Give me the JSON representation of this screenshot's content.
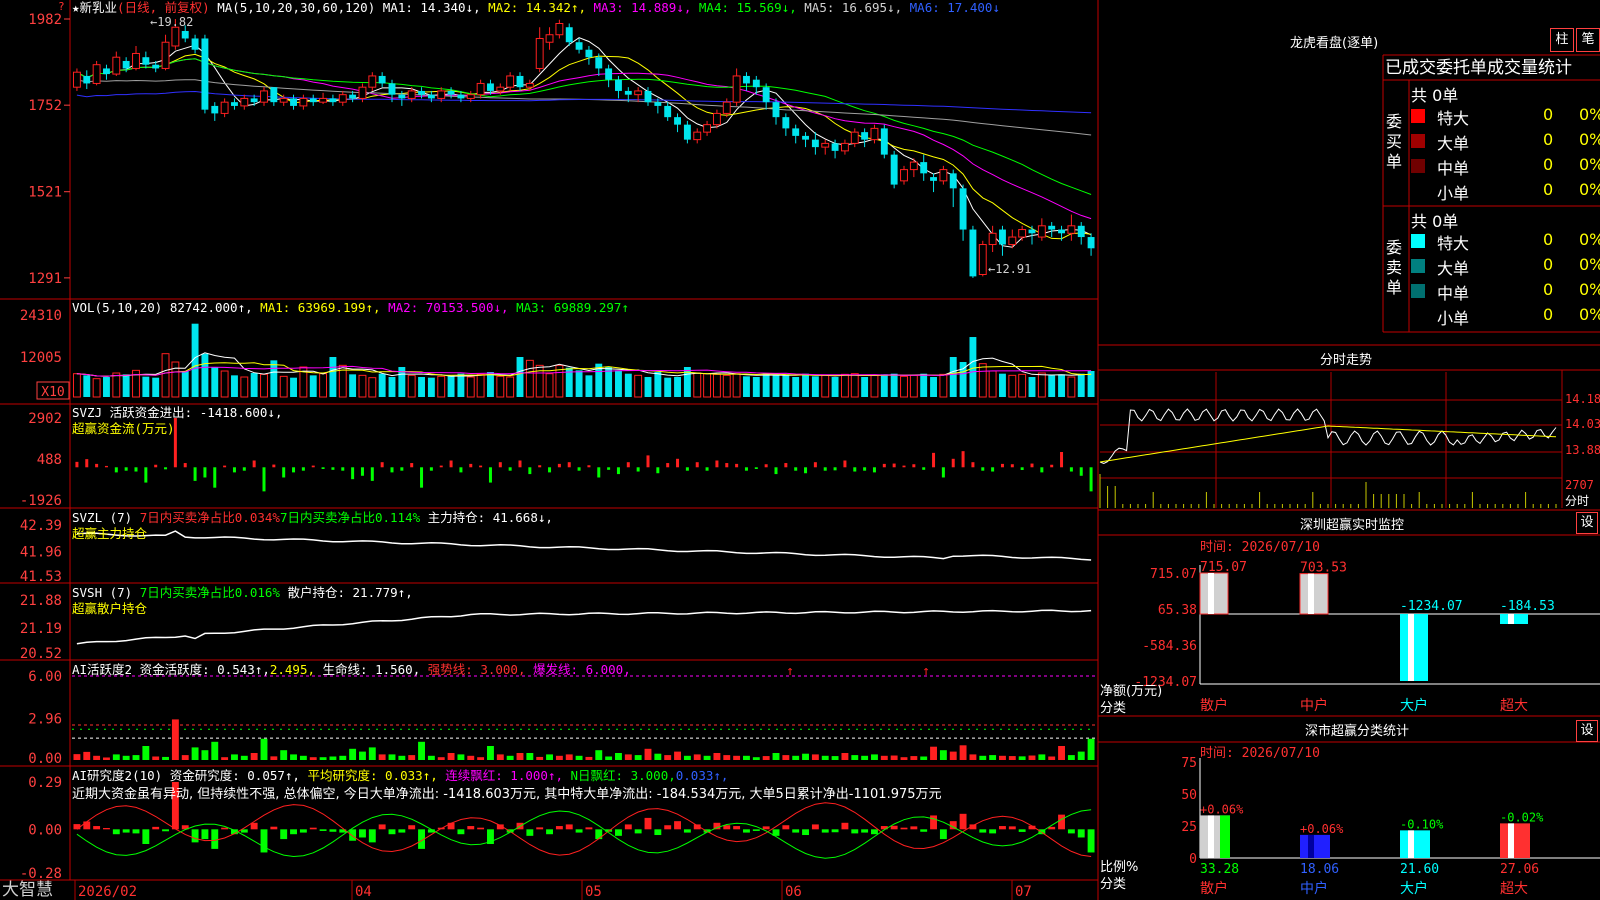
{
  "colors": {
    "up": "#ff2020",
    "down": "#00e5ee",
    "grid": "#b00000",
    "axis_text": "#ff4040",
    "ma1": "#ffffff",
    "ma2": "#ffff00",
    "ma3": "#ff00ff",
    "ma4": "#00ff00",
    "ma5": "#a0a0a0",
    "ma6": "#3030ff",
    "green_bar": "#00ff00",
    "gray_text": "#d0d0d0"
  },
  "header": {
    "star": "★",
    "stock_name": "新乳业",
    "period": "(日线, 前复权)",
    "ma_params": "MA(5,10,20,30,60,120)",
    "ma1": "MA1: 14.340↓,",
    "ma2": "MA2: 14.342↑,",
    "ma3": "MA3: 14.889↓,",
    "ma4": "MA4: 15.569↓,",
    "ma5": "MA5: 16.695↓,",
    "ma6": "MA6: 17.400↓",
    "high_label": "←19.82",
    "low_label": "←12.91",
    "scroll_icon": "?"
  },
  "chart_data": [
    {
      "type": "candlestick",
      "panel": "price",
      "y_ticks": [
        "1982",
        "1752",
        "1521",
        "1291"
      ],
      "ylim": [
        12.8,
        19.9
      ],
      "x_labels": [
        "2026/02",
        "04",
        "05",
        "06",
        "07"
      ],
      "high": 19.82,
      "low": 12.91,
      "candles": [
        [
          18.0,
          18.4,
          18.5,
          17.9
        ],
        [
          18.3,
          18.1,
          18.45,
          17.95
        ],
        [
          18.1,
          18.6,
          18.7,
          18.05
        ],
        [
          18.5,
          18.35,
          18.6,
          18.2
        ],
        [
          18.35,
          18.8,
          18.95,
          18.3
        ],
        [
          18.7,
          18.5,
          18.8,
          18.4
        ],
        [
          18.5,
          18.9,
          19.1,
          18.45
        ],
        [
          18.8,
          18.6,
          18.95,
          18.5
        ],
        [
          18.6,
          18.5,
          18.7,
          18.4
        ],
        [
          18.5,
          19.2,
          19.4,
          18.45
        ],
        [
          19.1,
          19.6,
          19.82,
          19.0
        ],
        [
          19.5,
          19.3,
          19.65,
          19.2
        ],
        [
          19.3,
          19.0,
          19.4,
          18.9
        ],
        [
          19.3,
          17.4,
          19.4,
          17.3
        ],
        [
          17.5,
          17.3,
          17.6,
          17.1
        ],
        [
          17.3,
          17.6,
          17.7,
          17.2
        ],
        [
          17.6,
          17.5,
          17.7,
          17.4
        ],
        [
          17.5,
          17.7,
          17.8,
          17.4
        ],
        [
          17.7,
          17.6,
          17.8,
          17.5
        ],
        [
          17.6,
          17.9,
          18.0,
          17.5
        ],
        [
          18.0,
          17.6,
          18.0,
          17.5
        ],
        [
          17.6,
          17.7,
          17.8,
          17.5
        ],
        [
          17.7,
          17.5,
          17.8,
          17.4
        ],
        [
          17.5,
          17.7,
          17.8,
          17.4
        ],
        [
          17.7,
          17.6,
          17.8,
          17.5
        ],
        [
          17.6,
          17.7,
          17.85,
          17.55
        ],
        [
          17.7,
          17.6,
          17.8,
          17.5
        ],
        [
          17.6,
          17.8,
          17.9,
          17.5
        ],
        [
          17.8,
          17.7,
          17.9,
          17.6
        ],
        [
          17.7,
          18.0,
          18.1,
          17.6
        ],
        [
          18.0,
          18.3,
          18.4,
          17.9
        ],
        [
          18.3,
          18.1,
          18.4,
          18.0
        ],
        [
          18.1,
          17.8,
          18.2,
          17.6
        ],
        [
          17.8,
          17.7,
          17.9,
          17.5
        ],
        [
          17.7,
          17.9,
          18.0,
          17.6
        ],
        [
          17.9,
          17.8,
          18.0,
          17.7
        ],
        [
          17.8,
          17.7,
          17.9,
          17.6
        ],
        [
          17.7,
          17.9,
          18.0,
          17.6
        ],
        [
          17.9,
          17.8,
          18.0,
          17.7
        ],
        [
          17.8,
          17.7,
          17.9,
          17.6
        ],
        [
          17.7,
          17.8,
          17.9,
          17.6
        ],
        [
          17.8,
          18.1,
          18.2,
          17.7
        ],
        [
          18.1,
          17.9,
          18.2,
          17.8
        ],
        [
          17.9,
          18.0,
          18.1,
          17.8
        ],
        [
          18.0,
          18.3,
          18.4,
          17.9
        ],
        [
          18.3,
          18.0,
          18.4,
          17.9
        ],
        [
          18.0,
          18.1,
          18.2,
          17.9
        ],
        [
          18.5,
          19.3,
          19.6,
          18.4
        ],
        [
          19.2,
          19.4,
          19.6,
          19.0
        ],
        [
          19.4,
          19.7,
          19.8,
          19.3
        ],
        [
          19.6,
          19.2,
          19.7,
          19.1
        ],
        [
          19.2,
          19.0,
          19.3,
          18.9
        ],
        [
          19.0,
          18.8,
          19.1,
          18.6
        ],
        [
          18.8,
          18.5,
          18.9,
          18.3
        ],
        [
          18.5,
          18.2,
          18.6,
          18.0
        ],
        [
          18.2,
          17.9,
          18.3,
          17.7
        ],
        [
          17.9,
          17.8,
          18.0,
          17.6
        ],
        [
          17.8,
          17.9,
          18.0,
          17.6
        ],
        [
          17.9,
          17.6,
          18.0,
          17.5
        ],
        [
          17.6,
          17.5,
          17.7,
          17.3
        ],
        [
          17.5,
          17.2,
          17.6,
          17.1
        ],
        [
          17.2,
          17.0,
          17.3,
          16.8
        ],
        [
          17.0,
          16.6,
          17.1,
          16.5
        ],
        [
          16.6,
          16.8,
          16.9,
          16.5
        ],
        [
          16.8,
          17.0,
          17.1,
          16.7
        ],
        [
          17.0,
          17.3,
          17.4,
          16.9
        ],
        [
          17.3,
          17.6,
          17.7,
          17.2
        ],
        [
          17.6,
          18.3,
          18.5,
          17.5
        ],
        [
          18.3,
          18.1,
          18.4,
          17.9
        ],
        [
          18.2,
          18.0,
          18.3,
          17.8
        ],
        [
          18.0,
          17.6,
          18.1,
          17.4
        ],
        [
          17.6,
          17.2,
          17.7,
          17.0
        ],
        [
          17.2,
          16.9,
          17.3,
          16.7
        ],
        [
          16.9,
          16.7,
          17.0,
          16.5
        ],
        [
          16.7,
          16.6,
          16.8,
          16.4
        ],
        [
          16.6,
          16.4,
          16.8,
          16.2
        ],
        [
          16.4,
          16.5,
          16.6,
          16.2
        ],
        [
          16.5,
          16.3,
          16.6,
          16.1
        ],
        [
          16.3,
          16.5,
          16.6,
          16.2
        ],
        [
          16.5,
          16.8,
          16.9,
          16.4
        ],
        [
          16.8,
          16.6,
          16.9,
          16.4
        ],
        [
          16.6,
          16.9,
          17.0,
          16.5
        ],
        [
          16.9,
          16.2,
          17.0,
          16.1
        ],
        [
          16.2,
          15.4,
          16.3,
          15.3
        ],
        [
          15.5,
          15.8,
          15.9,
          15.4
        ],
        [
          15.8,
          16.0,
          16.1,
          15.6
        ],
        [
          16.0,
          15.7,
          16.2,
          15.5
        ],
        [
          15.6,
          15.5,
          15.7,
          15.2
        ],
        [
          15.5,
          15.8,
          15.9,
          15.4
        ],
        [
          15.7,
          15.3,
          15.8,
          14.8
        ],
        [
          15.3,
          14.2,
          15.4,
          13.9
        ],
        [
          14.2,
          12.95,
          14.3,
          12.91
        ],
        [
          13.0,
          13.8,
          13.9,
          12.95
        ],
        [
          13.8,
          14.1,
          14.3,
          13.6
        ],
        [
          14.2,
          13.8,
          14.3,
          13.5
        ],
        [
          13.8,
          14.0,
          14.2,
          13.7
        ],
        [
          14.0,
          14.2,
          14.3,
          13.9
        ],
        [
          14.2,
          14.1,
          14.3,
          13.8
        ],
        [
          14.0,
          14.3,
          14.5,
          13.9
        ],
        [
          14.3,
          14.2,
          14.4,
          14.0
        ],
        [
          14.2,
          14.1,
          14.3,
          13.9
        ],
        [
          14.1,
          14.3,
          14.6,
          13.9
        ],
        [
          14.3,
          14.0,
          14.4,
          13.8
        ],
        [
          14.0,
          13.7,
          14.1,
          13.5
        ]
      ]
    },
    {
      "type": "bar",
      "panel": "volume",
      "label": "VOL(5,10,20)",
      "y_ticks": [
        "24310",
        "12005",
        "X10"
      ],
      "ylim": [
        0,
        24310
      ],
      "values": [
        7000,
        6500,
        5500,
        6000,
        7200,
        6800,
        8000,
        6100,
        5800,
        13000,
        10500,
        7800,
        22000,
        13000,
        9000,
        7800,
        6500,
        6000,
        7200,
        6800,
        11000,
        6200,
        5800,
        9000,
        6500,
        7000,
        12005,
        9500,
        6800,
        6500,
        5800,
        7000,
        6000,
        9000,
        6500,
        6000,
        5800,
        6200,
        6500,
        7000,
        6000,
        6800,
        7500,
        6200,
        6000,
        12005,
        11000,
        9500,
        7000,
        9500,
        8800,
        8000,
        6500,
        10000,
        9000,
        8000,
        7000,
        6500,
        6000,
        7500,
        5800,
        6000,
        9000,
        7200,
        7000,
        6800,
        6500,
        7000,
        6200,
        6000,
        7200,
        6500,
        6800,
        6000,
        7000,
        6200,
        6500,
        6000,
        6800,
        7000,
        6000,
        6500,
        6800,
        7000,
        6200,
        6500,
        7000,
        6000,
        6800,
        12005,
        10500,
        18000,
        10000,
        7800,
        7000,
        6500,
        6800,
        6000,
        7200,
        6500,
        6800,
        6000,
        7000,
        7800
      ],
      "vol_text": "82742.000↑,",
      "ma1": "MA1: 63969.199↑,",
      "ma2": "MA2: 70153.500↓,",
      "ma3": "MA3: 69889.297↑"
    },
    {
      "type": "bar",
      "panel": "capital_flow",
      "label": "SVZJ",
      "title": "超赢资金流(万元)",
      "y_ticks": [
        "2902",
        "488",
        "-1926"
      ],
      "ylim": [
        -1926,
        2902
      ],
      "values": [
        320,
        480,
        200,
        80,
        -300,
        -200,
        -250,
        -900,
        150,
        -120,
        2902,
        250,
        -800,
        -600,
        -1200,
        100,
        -300,
        -200,
        400,
        -1418,
        160,
        -600,
        -300,
        -200,
        100,
        -100,
        -150,
        -200,
        -700,
        -500,
        -800,
        300,
        -300,
        -200,
        250,
        -1200,
        -200,
        100,
        400,
        -300,
        200,
        100,
        -900,
        300,
        -200,
        400,
        -400,
        120,
        -300,
        200,
        300,
        -200,
        120,
        -600,
        -150,
        -400,
        300,
        -250,
        700,
        -350,
        250,
        500,
        -200,
        300,
        -200,
        400,
        250,
        200,
        -200,
        -100,
        180,
        -400,
        250,
        -200,
        -350,
        300,
        -200,
        -180,
        400,
        -250,
        -200,
        -300,
        200,
        220,
        100,
        180,
        -150,
        850,
        -600,
        500,
        950,
        300,
        -200,
        -250,
        200,
        180,
        -160,
        220,
        -300,
        150,
        900,
        -250,
        -500,
        -1418
      ]
    },
    {
      "type": "line",
      "panel": "main_holding",
      "label": "SVZL (7)",
      "title": "超赢主力持仓",
      "y_ticks": [
        "42.39",
        "41.96",
        "41.53"
      ],
      "ylim": [
        41.53,
        42.39
      ]
    },
    {
      "type": "line",
      "panel": "retail_holding",
      "label": "SVSH (7)",
      "title": "超赢散户持仓",
      "y_ticks": [
        "21.88",
        "21.19",
        "20.52"
      ],
      "ylim": [
        20.52,
        21.88
      ]
    },
    {
      "type": "bar",
      "panel": "ai_activity",
      "label": "AI活跃度2",
      "y_ticks": [
        "6.00",
        "2.96",
        "0.00"
      ],
      "ylim": [
        0,
        6
      ]
    },
    {
      "type": "bar",
      "panel": "ai_research",
      "label": "AI研究度2(10)",
      "y_ticks": [
        "0.29",
        "0.00",
        "-0.28"
      ],
      "ylim": [
        -0.28,
        0.29
      ]
    }
  ],
  "indicators": {
    "svzj_line": "活跃资金进出: -1418.600↓,",
    "svzl_a": "7日内买卖净占比0.034%",
    "svzl_b": "7日内买卖净占比0.114%",
    "svzl_c": "主力持仓: 41.668↓,",
    "svsh_a": "7日内买卖净占比0.016%",
    "svsh_b": "散户持仓: 21.779↑,",
    "ai_act_a": "资金活跃度: 0.543↑,",
    "ai_act_b": "2.495,",
    "ai_act_c": "生命线: 1.560,",
    "ai_act_d": "强势线: 3.000,",
    "ai_act_e": "爆发线: 6.000,",
    "ai_res_a": "资金研究度: 0.057↑,",
    "ai_res_b": "平均研究度: 0.033↑,",
    "ai_res_c": "连续飘红: 1.000↑,",
    "ai_res_d": "N日飘红: 3.000,",
    "ai_res_e": "0.033↑,",
    "summary": "近期大资金虽有异动, 但持续性不强, 总体偏空, 今日大单净流出: -1418.603万元, 其中特大单净流出: -184.534万元, 大单5日累计净出-1101.975万元"
  },
  "footer": {
    "brand": "大智慧"
  },
  "right_panel": {
    "lhb_title": "龙虎看盘(逐单)",
    "btn_zhu": "柱",
    "btn_bi": "笔",
    "order_header": "已成交委托单成交量统计",
    "buy_side_label": "委买单",
    "sell_side_label": "委卖单",
    "buy_total": "共 0单",
    "sell_total": "共 0单",
    "buy_rows": [
      {
        "label": "特大",
        "count": "0",
        "pct": "0%",
        "color": "#ff0000"
      },
      {
        "label": "大单",
        "count": "0",
        "pct": "0%",
        "color": "#a00000"
      },
      {
        "label": "中单",
        "count": "0",
        "pct": "0%",
        "color": "#700000"
      },
      {
        "label": "小单",
        "count": "0",
        "pct": "0%",
        "color": ""
      }
    ],
    "sell_rows": [
      {
        "label": "特大",
        "count": "0",
        "pct": "0%",
        "color": "#00ffff"
      },
      {
        "label": "大单",
        "count": "0",
        "pct": "0%",
        "color": "#008080"
      },
      {
        "label": "中单",
        "count": "0",
        "pct": "0%",
        "color": "#007070"
      },
      {
        "label": "小单",
        "count": "0",
        "pct": "0%",
        "color": ""
      }
    ],
    "intraday_title": "分时走势",
    "intraday_ticks": [
      "14.18",
      "14.03",
      "13.88",
      "2707",
      "分时"
    ],
    "sz_monitor_title": "深圳超赢实时监控",
    "sz_time": "时间: 2026/07/10",
    "sz_y_ticks": [
      "715.07",
      "65.38",
      "-584.36",
      "-1234.07"
    ],
    "sz_axis_label": "净额(万元)",
    "sz_axis_label2": "分类",
    "sz_categories": [
      "散户",
      "中户",
      "大户",
      "超大"
    ],
    "sz_values": [
      715.07,
      703.53,
      -1234.07,
      -184.53
    ],
    "sz_value_labels": [
      "715.07",
      "703.53",
      "-1234.07",
      "-184.53"
    ],
    "sz_set": "设",
    "sh_stats_title": "深市超赢分类统计",
    "sh_time": "时间: 2026/07/10",
    "sh_y_ticks": [
      "75",
      "50",
      "25",
      "0"
    ],
    "sh_axis_label": "比例%",
    "sh_axis_label2": "分类",
    "sh_categories": [
      "散户",
      "中户",
      "大户",
      "超大"
    ],
    "sh_values": [
      33.28,
      18.06,
      21.6,
      27.06
    ],
    "sh_value_labels": [
      "33.28",
      "18.06",
      "21.60",
      "27.06"
    ],
    "sh_change_labels": [
      "+0.06%",
      "+0.06%",
      "-0.10%",
      "-0.02%"
    ],
    "sh_set": "设"
  }
}
